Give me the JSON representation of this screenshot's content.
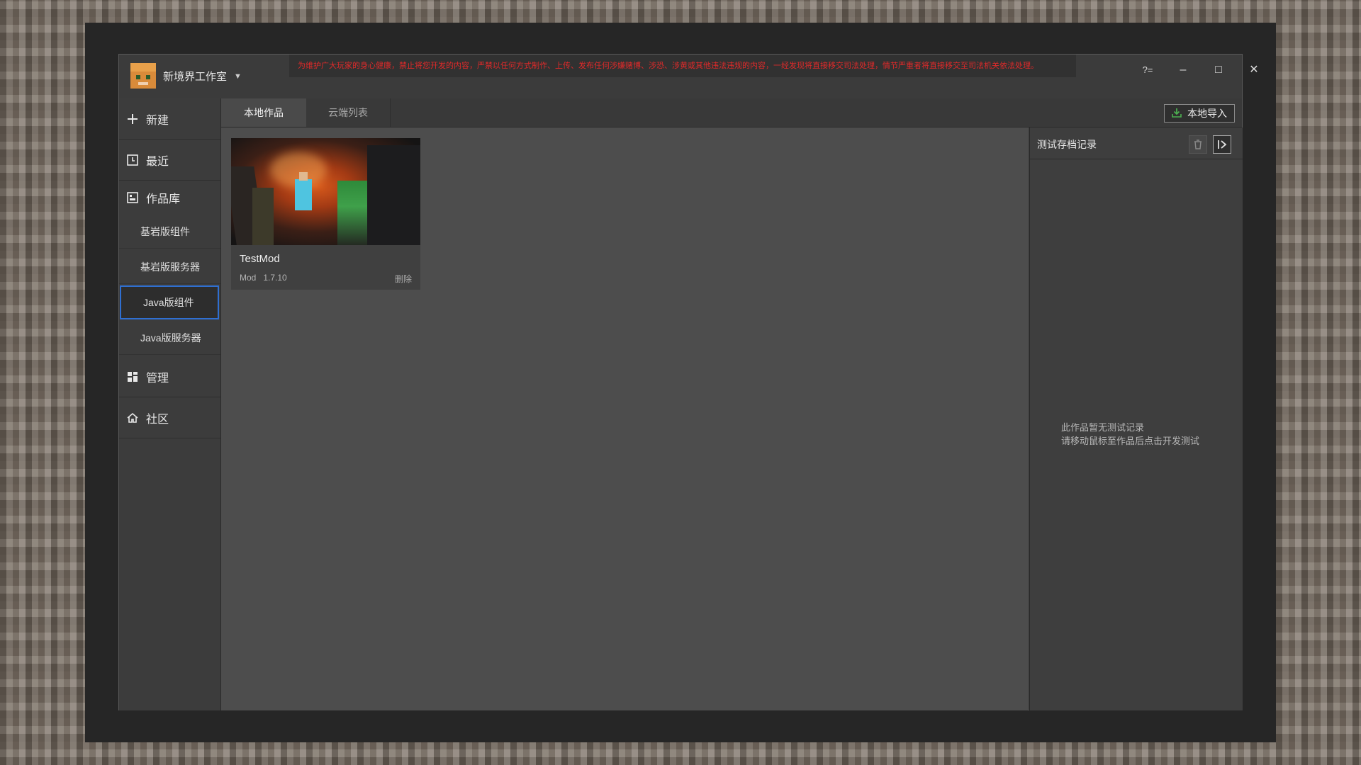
{
  "titlebar": {
    "studio_name": "新境界工作室",
    "notice": "为维护广大玩家的身心健康，禁止将您开发的内容，严禁以任何方式制作、上传、发布任何涉嫌赌博、涉恐、涉黄或其他违法违规的内容，一经发现将直接移交司法处理，情节严重者将直接移交至司法机关依法处理。",
    "help_glyph": "?=",
    "minimize_glyph": "–",
    "maximize_glyph": "□",
    "close_glyph": "✕"
  },
  "sidebar": {
    "new_label": "新建",
    "recent_label": "最近",
    "library_label": "作品库",
    "sub_items": [
      "基岩版组件",
      "基岩版服务器",
      "Java版组件",
      "Java版服务器"
    ],
    "active_sub": "Java版组件",
    "manage_label": "管理",
    "community_label": "社区"
  },
  "tabs": {
    "local": "本地作品",
    "cloud": "云端列表",
    "import_label": "本地导入"
  },
  "card": {
    "title": "TestMod",
    "type": "Mod",
    "version": "1.7.10",
    "delete_label": "删除"
  },
  "panel": {
    "title": "测试存档记录",
    "empty_line1": "此作品暂无测试记录",
    "empty_line2": "请移动鼠标至作品后点击开发测试"
  },
  "colors": {
    "active_border": "#2f6fd1",
    "notice_text": "#e02a2a",
    "import_icon": "#4caf50"
  },
  "icons": [
    "plus-icon",
    "clock-icon",
    "library-icon",
    "grid-icon",
    "home-icon",
    "download-icon",
    "trash-icon",
    "collapse-panel-icon"
  ]
}
